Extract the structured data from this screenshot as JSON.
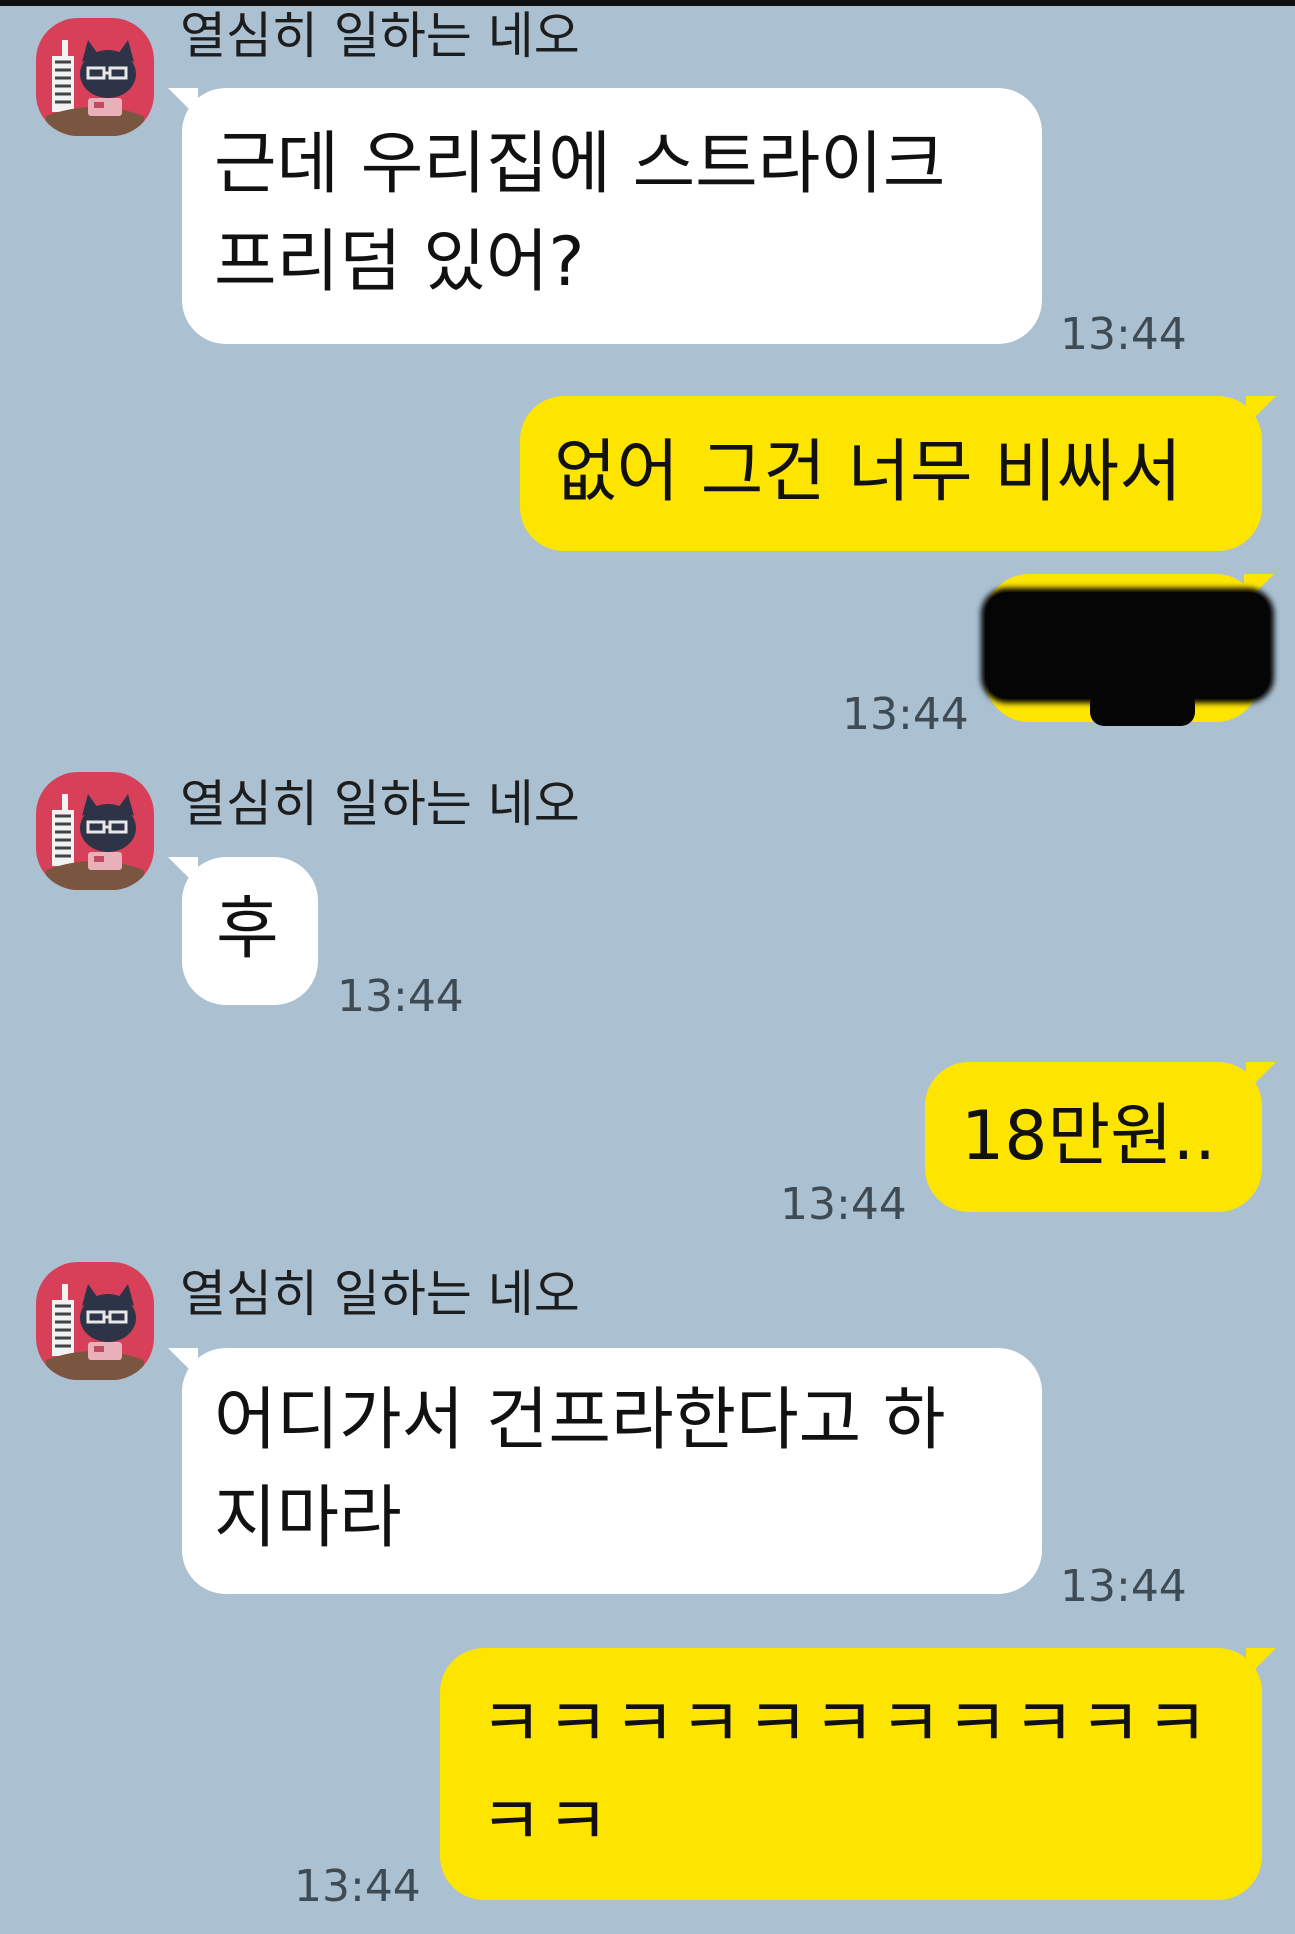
{
  "chat": {
    "messages": [
      {
        "direction": "incoming",
        "sender": "열심히 일하는 네오",
        "lines": [
          "근데 우리집에 스트라이크",
          "프리덤 있어?"
        ],
        "time": "13:44"
      },
      {
        "direction": "outgoing",
        "lines": [
          "없어 그건 너무 비싸서"
        ],
        "time": ""
      },
      {
        "direction": "outgoing",
        "lines": [],
        "redacted": true,
        "time": "13:44"
      },
      {
        "direction": "incoming",
        "sender": "열심히 일하는 네오",
        "lines": [
          "후"
        ],
        "time": "13:44"
      },
      {
        "direction": "outgoing",
        "lines": [
          "18만원.."
        ],
        "time": "13:44"
      },
      {
        "direction": "incoming",
        "sender": "열심히 일하는 네오",
        "lines": [
          "어디가서 건프라한다고 하",
          "지마라"
        ],
        "time": "13:44"
      },
      {
        "direction": "outgoing",
        "lines": [
          "ㅋㅋㅋㅋㅋㅋㅋㅋㅋㅋㅋ",
          "ㅋㅋ"
        ],
        "time": "13:44"
      }
    ]
  },
  "colors": {
    "background": "#abc1d1",
    "incoming_bubble": "#ffffff",
    "outgoing_bubble": "#fee500",
    "avatar_bg": "#d8405a",
    "redaction": "#050505"
  },
  "icons": {
    "avatar": "neo-character-avatar-icon"
  }
}
